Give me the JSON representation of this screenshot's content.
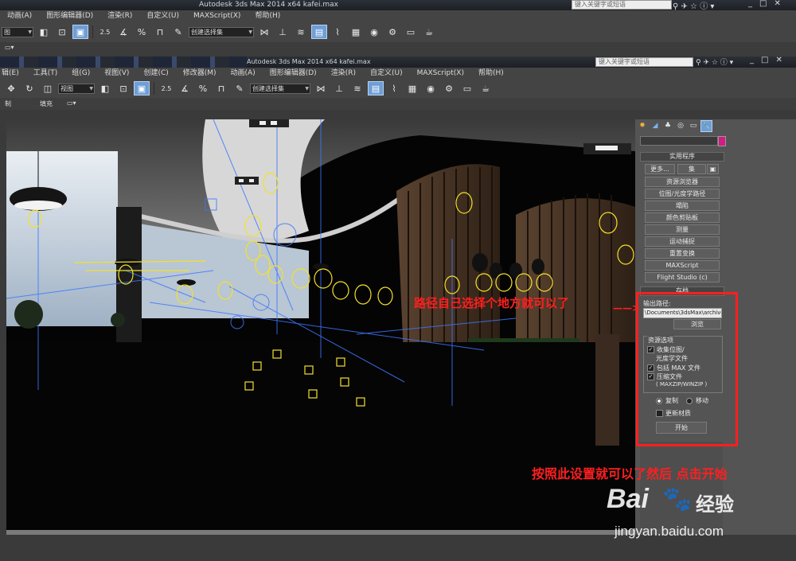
{
  "background_window": {
    "title": "Autodesk 3ds Max  2014 x64      kafei.max",
    "search_placeholder": "键入关键字或短语",
    "menu": [
      "动画(A)",
      "图形编辑器(D)",
      "渲染(R)",
      "自定义(U)",
      "MAXScript(X)",
      "帮助(H)"
    ],
    "view_combo": "图",
    "selection_set": "创建选择集",
    "snap_label": "2.5",
    "angle_label": "%"
  },
  "main_window": {
    "title": "Autodesk 3ds Max  2014 x64      kafei.max",
    "search_placeholder": "键入关键字或短语",
    "menu": [
      "辑(E)",
      "工具(T)",
      "组(G)",
      "视图(V)",
      "创建(C)",
      "修改器(M)",
      "动画(A)",
      "图形编辑器(D)",
      "渲染(R)",
      "自定义(U)",
      "MAXScript(X)",
      "帮助(H)"
    ],
    "view_combo": "视图",
    "selection_set": "创建选择集",
    "snap_label": "2.5",
    "ribbon_tabs": [
      "制",
      "填充"
    ]
  },
  "command_panel": {
    "utilities_header": "实用程序",
    "more_button": "更多...",
    "sets_button": "集",
    "utilities": [
      "资源浏览器",
      "位图/光度学路径",
      "塌陷",
      "颜色剪贴板",
      "测量",
      "运动捕捉",
      "重置变换",
      "MAXScript",
      "Flight Studio (c)"
    ],
    "archive_header": "存档",
    "output_path_label": "输出路径:",
    "output_path_value": "\\Documents\\3dsMax\\archives",
    "browse_button": "浏览",
    "resource_options_label": "资源选项",
    "collect_bitmaps": "收集位图/",
    "collect_bitmaps_2": "光度学文件",
    "include_max": "包括 MAX 文件",
    "compress": "压缩文件",
    "compress_2": "( MAXZIP/WINZIP )",
    "copy_radio": "复制",
    "move_radio": "移动",
    "update_materials": "更新材质",
    "start_button": "开始"
  },
  "annotations": {
    "path_note": "路径自己选择个地方就可以了",
    "arrow": "——>",
    "instruction": "按照此设置就可以了然后  点击开始"
  },
  "watermark": {
    "brand": "Bai",
    "brand_tail": "经验",
    "url": "jingyan.baidu.com"
  },
  "colors": {
    "annotation_red": "#ff1f1f",
    "active_tool_blue": "#6e9ed6",
    "panel_gray": "#545454",
    "wireframe_yellow": "#f3e12a",
    "color_swatch": "#d21b83"
  }
}
